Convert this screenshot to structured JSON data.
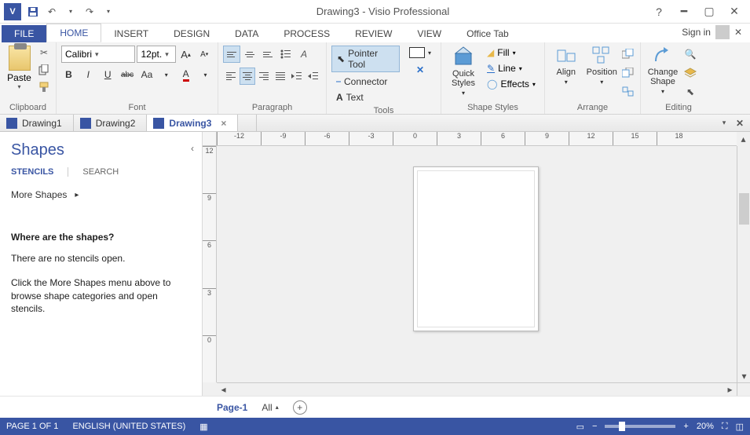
{
  "window": {
    "title": "Drawing3 - Visio Professional",
    "signin": "Sign in"
  },
  "tabs": {
    "file": "FILE",
    "items": [
      "HOME",
      "INSERT",
      "DESIGN",
      "DATA",
      "PROCESS",
      "REVIEW",
      "VIEW"
    ],
    "office": "Office Tab",
    "active": "HOME"
  },
  "ribbon": {
    "clipboard": {
      "label": "Clipboard",
      "paste": "Paste"
    },
    "font": {
      "label": "Font",
      "name": "Calibri",
      "size": "12pt.",
      "buttons": {
        "bold": "B",
        "italic": "I",
        "underline": "U",
        "strike": "abc",
        "case": "Aa",
        "color": "A"
      }
    },
    "paragraph": {
      "label": "Paragraph"
    },
    "tools": {
      "label": "Tools",
      "pointer": "Pointer Tool",
      "connector": "Connector",
      "text": "Text"
    },
    "shapestyles": {
      "label": "Shape Styles",
      "quick": "Quick Styles",
      "fill": "Fill",
      "line": "Line",
      "effects": "Effects"
    },
    "arrange": {
      "label": "Arrange",
      "align": "Align",
      "position": "Position"
    },
    "editing": {
      "label": "Editing",
      "change": "Change Shape"
    }
  },
  "doctabs": {
    "items": [
      "Drawing1",
      "Drawing2",
      "Drawing3"
    ],
    "active": "Drawing3"
  },
  "shapes": {
    "title": "Shapes",
    "stencils": "STENCILS",
    "search": "SEARCH",
    "more": "More Shapes",
    "help_h": "Where are the shapes?",
    "help_p1": "There are no stencils open.",
    "help_p2": "Click the More Shapes menu above to browse shape categories and open stencils."
  },
  "ruler": {
    "h": [
      "-12",
      "-9",
      "-6",
      "-3",
      "0",
      "3",
      "6",
      "9",
      "12",
      "15",
      "18"
    ],
    "v": [
      "12",
      "9",
      "6",
      "3",
      "0"
    ]
  },
  "pagetabs": {
    "page": "Page-1",
    "all": "All"
  },
  "status": {
    "page": "PAGE 1 OF 1",
    "lang": "ENGLISH (UNITED STATES)",
    "zoom": "20%"
  }
}
